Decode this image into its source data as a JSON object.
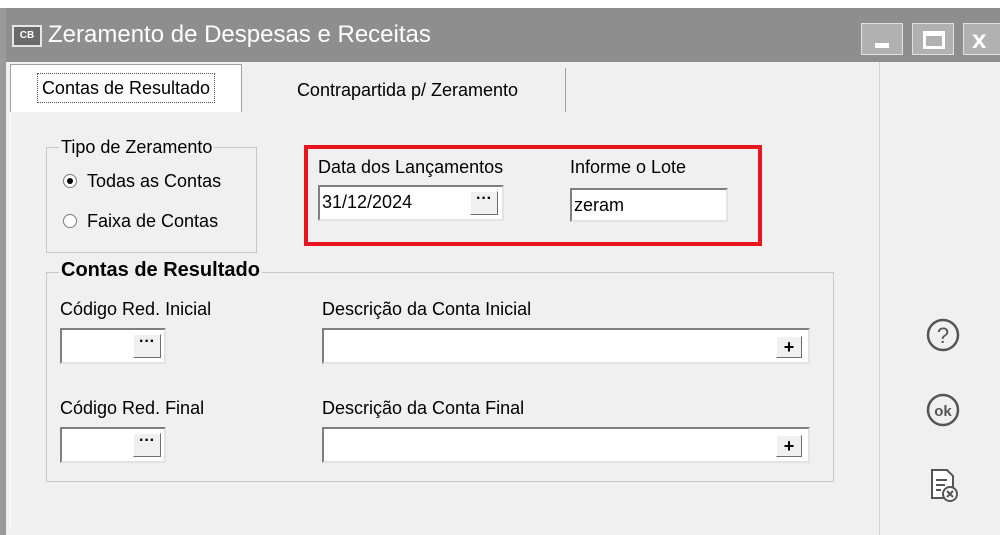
{
  "window": {
    "title": "Zeramento de Despesas e Receitas",
    "app_icon_text": "CB",
    "colors": {
      "titlebar": "#8e8e8e",
      "highlight": "#e8141f"
    }
  },
  "tabs": [
    {
      "label": "Contas de Resultado",
      "active": true
    },
    {
      "label": "Contrapartida p/ Zeramento",
      "active": false
    }
  ],
  "tipo_zeramento": {
    "legend": "Tipo de Zeramento",
    "options": [
      {
        "label": "Todas as Contas",
        "selected": true
      },
      {
        "label": "Faixa de Contas",
        "selected": false
      }
    ]
  },
  "data_lancamentos": {
    "label": "Data dos Lançamentos",
    "value": "31/12/2024",
    "button": "···"
  },
  "lote": {
    "label": "Informe o Lote",
    "value": "zeram"
  },
  "contas_resultado": {
    "legend": "Contas de Resultado",
    "cod_inicial_label": "Código Red. Inicial",
    "desc_inicial_label": "Descrição da Conta Inicial",
    "cod_final_label": "Código Red. Final",
    "desc_final_label": "Descrição da Conta Final",
    "cod_inicial_value": "",
    "desc_inicial_value": "",
    "cod_final_value": "",
    "desc_final_value": "",
    "ellipsis": "···",
    "plus": "+"
  },
  "side_icons": [
    "help-icon",
    "ok-icon",
    "report-cancel-icon"
  ]
}
